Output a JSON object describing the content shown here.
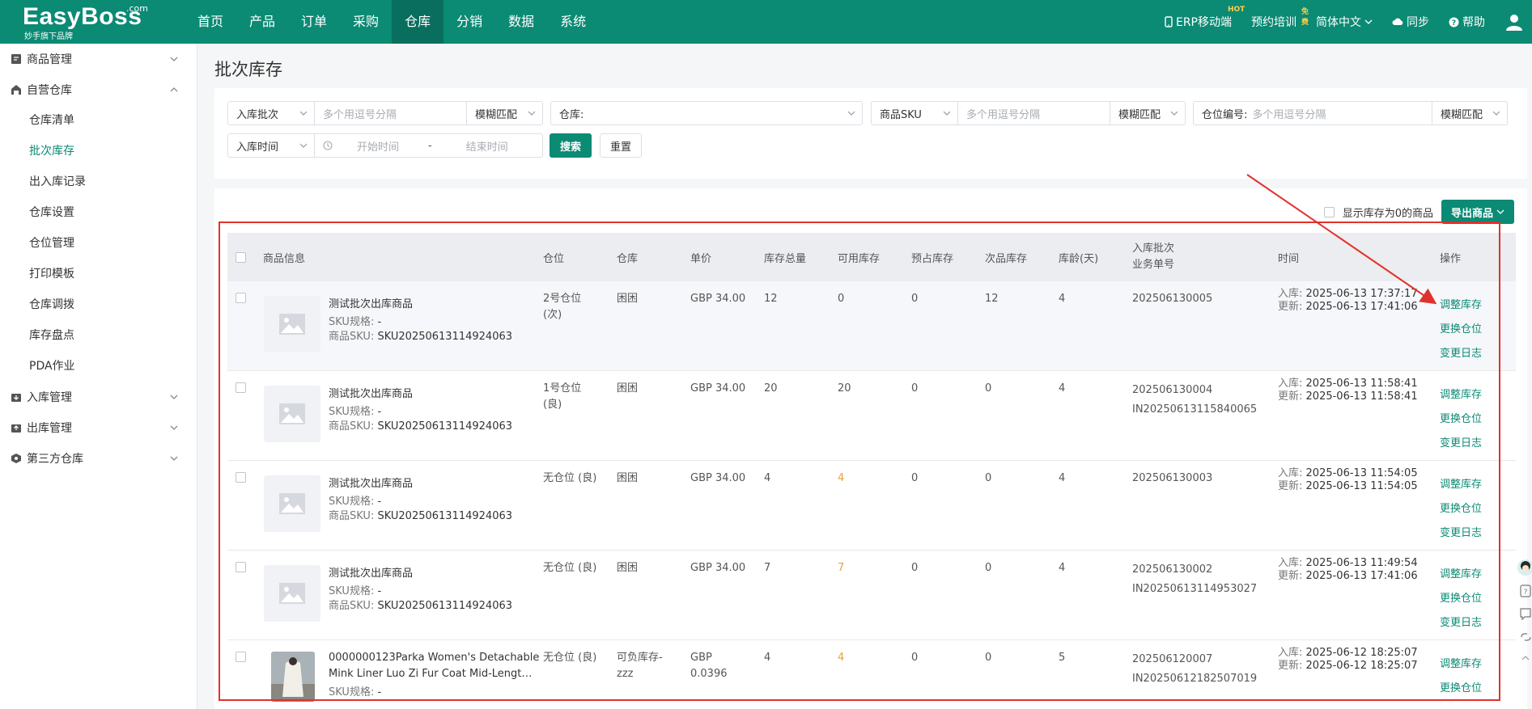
{
  "brand": {
    "name": "EasyBoss",
    "com": ".com",
    "tagline": "妙手旗下品牌"
  },
  "nav": [
    "首页",
    "产品",
    "订单",
    "采购",
    "仓库",
    "分销",
    "数据",
    "系统"
  ],
  "nav_active": "仓库",
  "right_nav": {
    "erp": "ERP移动端",
    "erp_badge": "HOT",
    "training": "预约培训",
    "training_badge": "免费",
    "lang": "简体中文",
    "sync": "同步",
    "help": "帮助"
  },
  "sidebar": {
    "groups": [
      {
        "label": "商品管理",
        "icon": "goods-icon",
        "expanded": false
      },
      {
        "label": "自营仓库",
        "icon": "warehouse-icon",
        "expanded": true
      },
      {
        "label": "入库管理",
        "icon": "inbound-icon",
        "expanded": false
      },
      {
        "label": "出库管理",
        "icon": "outbound-icon",
        "expanded": false
      },
      {
        "label": "第三方仓库",
        "icon": "third-party-icon",
        "expanded": false
      }
    ],
    "subitems": [
      "仓库清单",
      "批次库存",
      "出入库记录",
      "仓库设置",
      "仓位管理",
      "打印模板",
      "仓库调拨",
      "库存盘点",
      "PDA作业"
    ],
    "active_sub": "批次库存"
  },
  "page_title": "批次库存",
  "filters": {
    "batch_select": "入库批次",
    "batch_placeholder": "多个用逗号分隔",
    "match1": "模糊匹配",
    "warehouse_label": "仓库:",
    "sku_select": "商品SKU",
    "sku_placeholder": "多个用逗号分隔",
    "match2": "模糊匹配",
    "location_label": "仓位编号:",
    "location_placeholder": "多个用逗号分隔",
    "match3": "模糊匹配",
    "time_select": "入库时间",
    "start_placeholder": "开始时间",
    "dash": "-",
    "end_placeholder": "结束时间",
    "search": "搜索",
    "reset": "重置"
  },
  "toolbar": {
    "show_zero": "显示库存为0的商品",
    "export": "导出商品"
  },
  "columns": {
    "info": "商品信息",
    "location": "仓位",
    "warehouse": "仓库",
    "price": "单价",
    "total": "库存总量",
    "available": "可用库存",
    "reserved": "预占库存",
    "defective": "次品库存",
    "age": "库龄(天)",
    "batch": "入库批次",
    "order": "业务单号",
    "time": "时间",
    "ops": "操作"
  },
  "labels": {
    "sku_spec": "SKU规格:",
    "product_sku": "商品SKU:",
    "in": "入库:",
    "updated": "更新:"
  },
  "rows": [
    {
      "name": "测试批次出库商品",
      "spec": "-",
      "sku": "SKU20250613114924063",
      "loc1": "2号仓位",
      "loc2": "(次)",
      "wh1": "困困",
      "wh2": "",
      "price1": "GBP 34.00",
      "price2": "",
      "total": "12",
      "available": "0",
      "reserved": "0",
      "defective": "12",
      "age": "4",
      "batch": "202506130005",
      "order": "",
      "in_time": "2025-06-13 17:37:17",
      "up_time": "2025-06-13 17:41:06",
      "has_photo": false
    },
    {
      "name": "测试批次出库商品",
      "spec": "-",
      "sku": "SKU20250613114924063",
      "loc1": "1号仓位",
      "loc2": "(良)",
      "wh1": "困困",
      "wh2": "",
      "price1": "GBP 34.00",
      "price2": "",
      "total": "20",
      "available": "20",
      "reserved": "0",
      "defective": "0",
      "age": "4",
      "batch": "202506130004",
      "order": "IN20250613115840065",
      "in_time": "2025-06-13 11:58:41",
      "up_time": "2025-06-13 11:58:41",
      "has_photo": false
    },
    {
      "name": "测试批次出库商品",
      "spec": "-",
      "sku": "SKU20250613114924063",
      "loc1": "无仓位 (良)",
      "loc2": "",
      "wh1": "困困",
      "wh2": "",
      "price1": "GBP 34.00",
      "price2": "",
      "total": "4",
      "available": "4",
      "reserved": "0",
      "defective": "0",
      "age": "4",
      "batch": "202506130003",
      "order": "",
      "in_time": "2025-06-13 11:54:05",
      "up_time": "2025-06-13 11:54:05",
      "has_photo": false
    },
    {
      "name": "测试批次出库商品",
      "spec": "-",
      "sku": "SKU20250613114924063",
      "loc1": "无仓位 (良)",
      "loc2": "",
      "wh1": "困困",
      "wh2": "",
      "price1": "GBP 34.00",
      "price2": "",
      "total": "7",
      "available": "7",
      "reserved": "0",
      "defective": "0",
      "age": "4",
      "batch": "202506130002",
      "order": "IN20250613114953027",
      "in_time": "2025-06-13 11:49:54",
      "up_time": "2025-06-13 17:41:06",
      "has_photo": false
    },
    {
      "name": "0000000123Parka Women's Detachable",
      "name2": "Mink Liner Luo Zi Fur Coat Mid-Lengt…",
      "spec": "-",
      "sku": "",
      "loc1": "无仓位 (良)",
      "loc2": "",
      "wh1": "可负库存-",
      "wh2": "zzz",
      "price1": "GBP",
      "price2": "0.0396",
      "total": "4",
      "available": "4",
      "reserved": "0",
      "defective": "0",
      "age": "5",
      "batch": "202506120007",
      "order": "IN20250612182507019",
      "in_time": "2025-06-12 18:25:07",
      "up_time": "2025-06-12 18:25:07",
      "has_photo": true
    }
  ],
  "ops": [
    "调整库存",
    "更换仓位",
    "变更日志"
  ],
  "colors": {
    "brand": "#0b8a74",
    "highlight": "#e0322d"
  }
}
